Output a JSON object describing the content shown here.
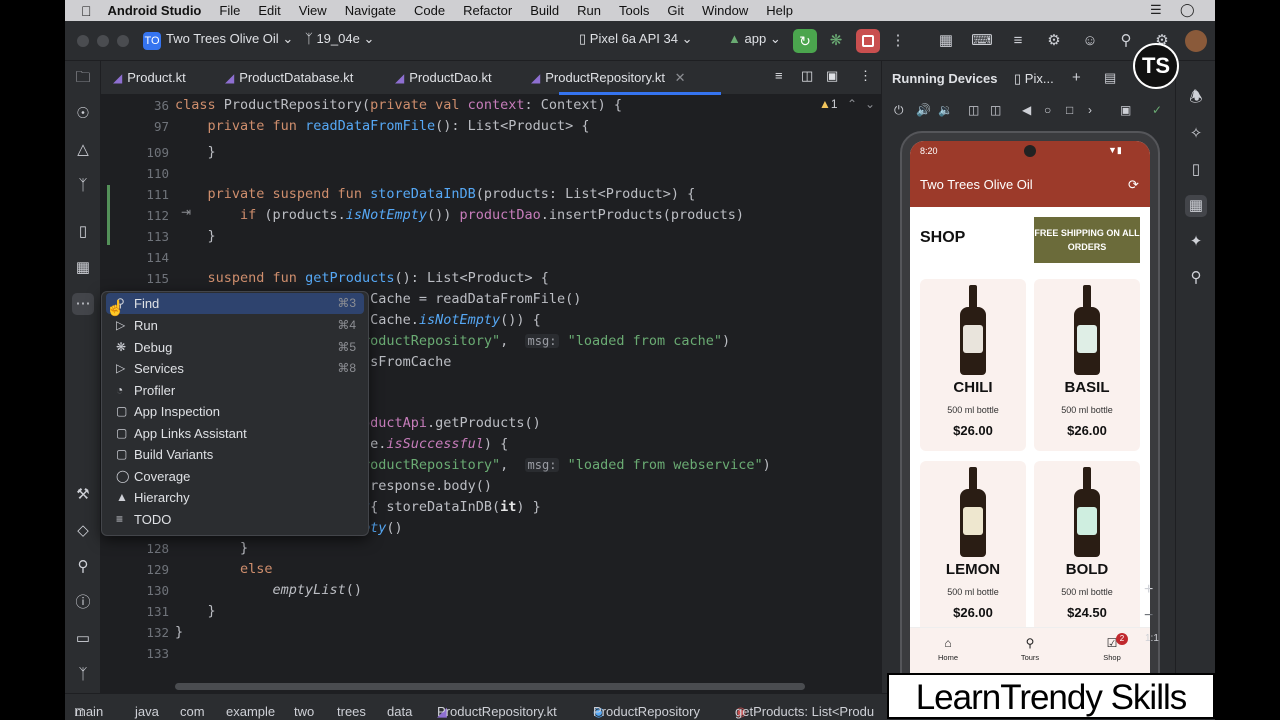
{
  "menubar": {
    "app": "Android Studio",
    "items": [
      "File",
      "Edit",
      "View",
      "Navigate",
      "Code",
      "Refactor",
      "Build",
      "Run",
      "Tools",
      "Git",
      "Window",
      "Help"
    ]
  },
  "toolbar": {
    "project_badge": "TO",
    "project": "Two Trees Olive Oil",
    "branch": "19_04e",
    "device": "Pixel 6a API 34",
    "config": "app"
  },
  "tabs": [
    "Product.kt",
    "ProductDatabase.kt",
    "ProductDao.kt",
    "ProductRepository.kt"
  ],
  "editor": {
    "warning_count": "1",
    "lines": [
      {
        "n": "36"
      },
      {
        "n": "97"
      },
      {
        "n": "109"
      },
      {
        "n": "110"
      },
      {
        "n": "111"
      },
      {
        "n": "112"
      },
      {
        "n": "113"
      },
      {
        "n": "114"
      },
      {
        "n": "115"
      },
      {
        "n": "128"
      },
      {
        "n": "129"
      },
      {
        "n": "130"
      },
      {
        "n": "131"
      },
      {
        "n": "132"
      },
      {
        "n": "133"
      }
    ]
  },
  "popup": {
    "items": [
      {
        "label": "Find",
        "shortcut": "⌘3",
        "icon": "search-icon"
      },
      {
        "label": "Run",
        "shortcut": "⌘4",
        "icon": "run-icon"
      },
      {
        "label": "Debug",
        "shortcut": "⌘5",
        "icon": "debug-icon"
      },
      {
        "label": "Services",
        "shortcut": "⌘8",
        "icon": "services-icon"
      },
      {
        "label": "Profiler",
        "shortcut": "",
        "icon": "profiler-icon"
      },
      {
        "label": "App Inspection",
        "shortcut": "",
        "icon": "app-inspection-icon"
      },
      {
        "label": "App Links Assistant",
        "shortcut": "",
        "icon": "app-links-icon"
      },
      {
        "label": "Build Variants",
        "shortcut": "",
        "icon": "build-variants-icon"
      },
      {
        "label": "Coverage",
        "shortcut": "",
        "icon": "coverage-icon"
      },
      {
        "label": "Hierarchy",
        "shortcut": "",
        "icon": "hierarchy-icon"
      },
      {
        "label": "TODO",
        "shortcut": "",
        "icon": "todo-icon"
      }
    ]
  },
  "running": {
    "title": "Running Devices",
    "tab": "Pix..."
  },
  "phone": {
    "time": "8:20",
    "app_title": "Two Trees Olive Oil",
    "shop": "SHOP",
    "shipping": "FREE SHIPPING ON ALL ORDERS",
    "products": [
      {
        "name": "CHILI",
        "size": "500 ml bottle",
        "price": "$26.00",
        "label_color": "#e9e4dc"
      },
      {
        "name": "BASIL",
        "size": "500 ml bottle",
        "price": "$26.00",
        "label_color": "#dfeee6"
      },
      {
        "name": "LEMON",
        "size": "500 ml bottle",
        "price": "$26.00",
        "label_color": "#eee7cf"
      },
      {
        "name": "BOLD",
        "size": "500 ml bottle",
        "price": "$24.50",
        "label_color": "#cfeee0"
      }
    ],
    "nav": [
      {
        "label": "Home"
      },
      {
        "label": "Tours"
      },
      {
        "label": "Shop",
        "badge": "2"
      }
    ]
  },
  "zoom": {
    "label": "1:1"
  },
  "breadcrumb": [
    "main",
    "java",
    "com",
    "example",
    "two",
    "trees",
    "data",
    "ProductRepository.kt",
    "ProductRepository",
    "getProducts: List<Produ"
  ],
  "watermark": "LearnTrendy Skills",
  "logo": "TS"
}
